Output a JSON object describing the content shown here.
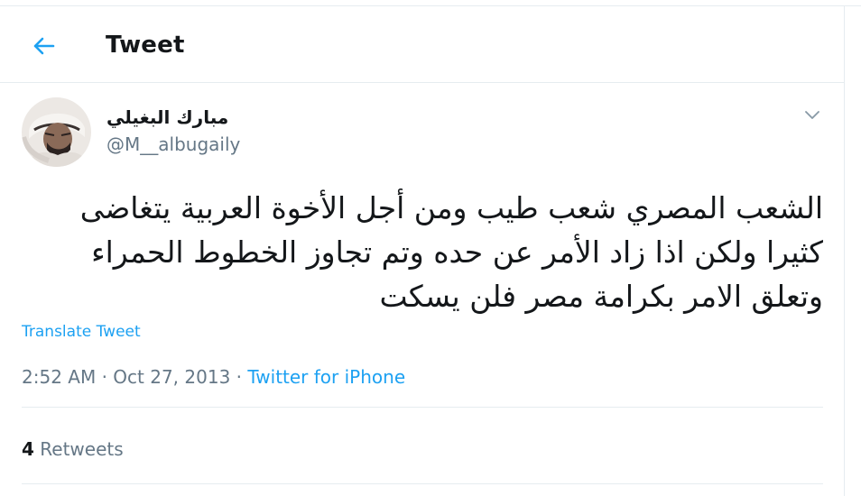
{
  "header": {
    "title": "Tweet",
    "back_icon": "arrow-left-icon"
  },
  "tweet": {
    "display_name": "مبارك البغيلي",
    "handle": "@M__albugaily",
    "text_lines": [
      "الشعب المصري شعب طيب ومن أجل الأخوة العربية يتغاضى",
      "كثيرا ولكن اذا زاد الأمر عن حده وتم تجاوز الخطوط الحمراء",
      "وتعلق الامر بكرامة مصر فلن يسكت"
    ],
    "translate_label": "Translate Tweet",
    "time": "2:52 AM",
    "date": "Oct 27, 2013",
    "dot": "·",
    "source": "Twitter for iPhone",
    "retweet_count": "4",
    "retweet_label": "Retweets",
    "caret_icon": "chevron-down-icon"
  },
  "colors": {
    "accent": "#1da1f2",
    "text": "#14171a",
    "muted": "#657786",
    "divider": "#e6ecf0"
  }
}
